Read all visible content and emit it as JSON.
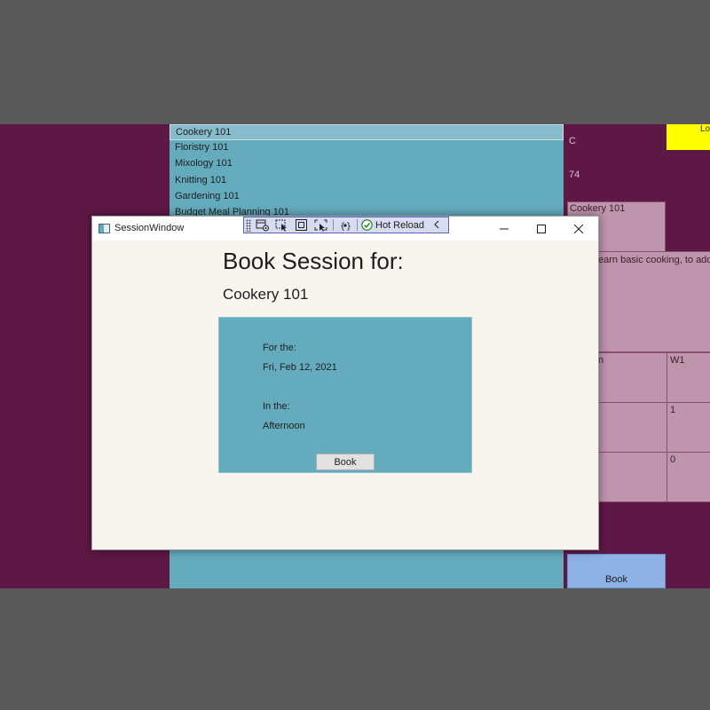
{
  "background_app": {
    "courses": [
      "Cookery 101",
      "Floristry 101",
      "Mixology 101",
      "Knitting 101",
      "Gardening 101",
      "Budget Meal Planning 101"
    ],
    "selected_course": "Cookery 101",
    "info_c": "C",
    "info_count": "74",
    "detail_title": "Cookery 101",
    "detail_description": "earn basic cooking, to add",
    "grid_header_left": "n",
    "grid_header_w1": "W1",
    "grid_val_1": "1",
    "grid_val_0": "0",
    "corner_label": "Lo",
    "book_label": "Book"
  },
  "window": {
    "title": "SessionWindow",
    "toolbar": {
      "hot_reload_label": "Hot Reload"
    },
    "heading": "Book Session for:",
    "course_name": "Cookery 101",
    "panel": {
      "for_label": "For the:",
      "date": "Fri, Feb 12, 2021",
      "in_label": "In the:",
      "time_of_day": "Afternoon",
      "book_button": "Book"
    }
  },
  "colors": {
    "background_app": "#5e1845",
    "list_teal": "#64abbd",
    "window_bg": "#f8f4ee",
    "pink_panel": "#bf94ad",
    "highlight_yellow": "#ffff00",
    "bg_book_button": "#8eb1e6"
  },
  "icons": [
    "window-icon",
    "toolbar-grip",
    "visual-tree-icon",
    "select-element-icon",
    "layout-adorner-icon",
    "track-focus-icon",
    "binding-failures-icon",
    "hot-reload-check-icon",
    "collapse-chevron-icon",
    "minimize-icon",
    "maximize-icon",
    "close-icon"
  ]
}
